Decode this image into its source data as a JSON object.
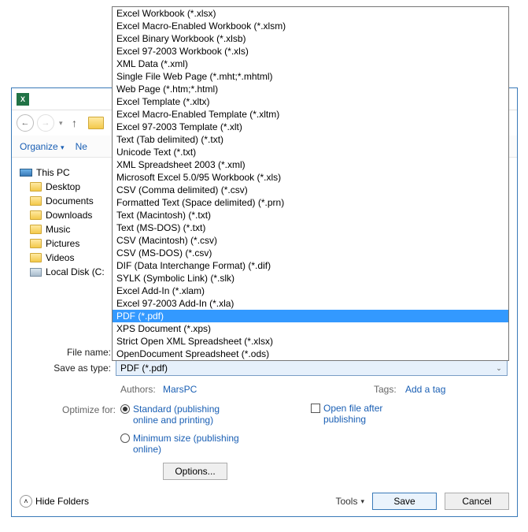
{
  "toolbar": {
    "organize": "Organize",
    "new": "Ne"
  },
  "sidebar": {
    "items": [
      {
        "label": "This PC",
        "icon": "pc"
      },
      {
        "label": "Desktop",
        "icon": "folder"
      },
      {
        "label": "Documents",
        "icon": "folder"
      },
      {
        "label": "Downloads",
        "icon": "folder"
      },
      {
        "label": "Music",
        "icon": "folder"
      },
      {
        "label": "Pictures",
        "icon": "folder"
      },
      {
        "label": "Videos",
        "icon": "folder"
      },
      {
        "label": "Local Disk (C:",
        "icon": "disk"
      }
    ]
  },
  "labels": {
    "file_name": "File name:",
    "save_as_type": "Save as type:",
    "authors": "Authors:",
    "tags": "Tags:",
    "optimize_for": "Optimize for:",
    "hide_folders": "Hide Folders",
    "tools": "Tools"
  },
  "values": {
    "save_as_type": "PDF (*.pdf)",
    "authors": "MarsPC",
    "tags": "Add a tag"
  },
  "optimize": {
    "standard": "Standard (publishing online and printing)",
    "minimum": "Minimum size (publishing online)"
  },
  "checkbox": {
    "open_after": "Open file after publishing"
  },
  "buttons": {
    "options": "Options...",
    "save": "Save",
    "cancel": "Cancel"
  },
  "dropdown": {
    "options": [
      "Excel Workbook (*.xlsx)",
      "Excel Macro-Enabled Workbook (*.xlsm)",
      "Excel Binary Workbook (*.xlsb)",
      "Excel 97-2003 Workbook (*.xls)",
      "XML Data (*.xml)",
      "Single File Web Page (*.mht;*.mhtml)",
      "Web Page (*.htm;*.html)",
      "Excel Template (*.xltx)",
      "Excel Macro-Enabled Template (*.xltm)",
      "Excel 97-2003 Template (*.xlt)",
      "Text (Tab delimited) (*.txt)",
      "Unicode Text (*.txt)",
      "XML Spreadsheet 2003 (*.xml)",
      "Microsoft Excel 5.0/95 Workbook (*.xls)",
      "CSV (Comma delimited) (*.csv)",
      "Formatted Text (Space delimited) (*.prn)",
      "Text (Macintosh) (*.txt)",
      "Text (MS-DOS) (*.txt)",
      "CSV (Macintosh) (*.csv)",
      "CSV (MS-DOS) (*.csv)",
      "DIF (Data Interchange Format) (*.dif)",
      "SYLK (Symbolic Link) (*.slk)",
      "Excel Add-In (*.xlam)",
      "Excel 97-2003 Add-In (*.xla)",
      "PDF (*.pdf)",
      "XPS Document (*.xps)",
      "Strict Open XML Spreadsheet (*.xlsx)",
      "OpenDocument Spreadsheet (*.ods)"
    ],
    "selected_index": 24
  }
}
